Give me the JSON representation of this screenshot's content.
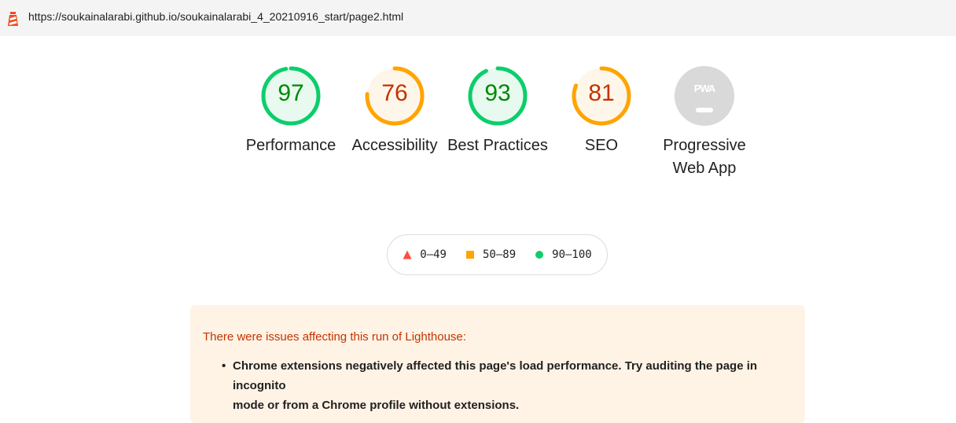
{
  "url_bar": {
    "url": "https://soukainalarabi.github.io/soukainalarabi_4_20210916_start/page2.html",
    "icon": "lighthouse-icon"
  },
  "gauges": [
    {
      "score": "97",
      "label": "Performance",
      "value": 97,
      "color": "#0cce6b",
      "text_color": "#008800",
      "bg": "#e8faf0"
    },
    {
      "score": "76",
      "label": "Accessibility",
      "value": 76,
      "color": "#ffa400",
      "text_color": "#c33300",
      "bg": "#fff6ea"
    },
    {
      "score": "93",
      "label": "Best Practices",
      "value": 93,
      "color": "#0cce6b",
      "text_color": "#008800",
      "bg": "#e8faf0"
    },
    {
      "score": "81",
      "label": "SEO",
      "value": 81,
      "color": "#ffa400",
      "text_color": "#c33300",
      "bg": "#fff6ea"
    }
  ],
  "pwa": {
    "badge": "PWA",
    "label_line1": "Progressive",
    "label_line2": "Web App",
    "color": "#d9d9d9"
  },
  "legend": {
    "fail": {
      "range": "0–49",
      "color": "#ff4e42",
      "icon": "triangle-icon"
    },
    "average": {
      "range": "50–89",
      "color": "#ffa400",
      "icon": "square-icon"
    },
    "pass": {
      "range": "90–100",
      "color": "#0cce6b",
      "icon": "circle-icon"
    }
  },
  "warning": {
    "title": "There were issues affecting this run of Lighthouse:",
    "items": [
      {
        "line1": "Chrome extensions negatively affected this page's load performance. Try auditing the page in incognito",
        "line2": "mode or from a Chrome profile without extensions."
      }
    ]
  }
}
